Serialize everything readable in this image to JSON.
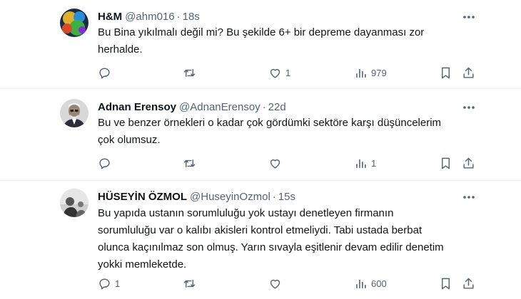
{
  "tweets": [
    {
      "name": "H&M",
      "handle": "@ahm016",
      "sep": "·",
      "time": "18s",
      "lines": [
        "Bu Bina yıkılmalı değil mi? Bu şekilde 6+ bir depreme dayanması zor",
        "herhalde."
      ],
      "stats": {
        "replies": "",
        "retweets": "",
        "likes": "1",
        "views": "979"
      }
    },
    {
      "name": "Adnan Erensoy",
      "handle": "@AdnanErensoy",
      "sep": "·",
      "time": "22d",
      "lines": [
        "Bu ve benzer örnekleri o kadar çok gördümki sektöre karşı düşüncelerim",
        "çok olumsuz."
      ],
      "stats": {
        "replies": "",
        "retweets": "",
        "likes": "",
        "views": "1"
      }
    },
    {
      "name": "HÜSEYİN ÖZMOL",
      "handle": "@HuseyinOzmol",
      "sep": "·",
      "time": "15s",
      "lines": [
        "Bu yapıda ustanın sorumluluğu yok ustayı denetleyen firmanın",
        "sorumluluğu var o kalıbı akisleri kontrol etmeliydi. Tabi ustada berbat",
        "olunca kaçınılmaz son olmuş. Yarın sıvayla eşitlenir devam edilir denetim",
        "yokki memleketde."
      ],
      "stats": {
        "replies": "1",
        "retweets": "",
        "likes": "",
        "views": "600"
      }
    }
  ]
}
